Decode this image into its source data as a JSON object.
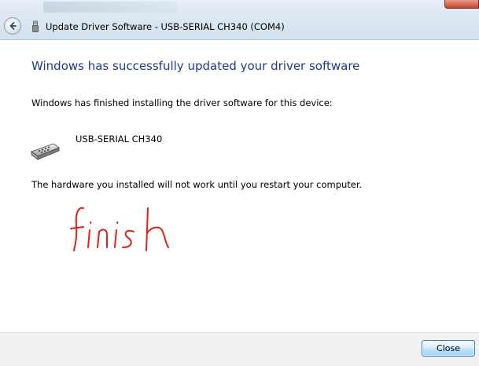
{
  "window": {
    "title": "Update Driver Software - USB-SERIAL CH340 (COM4)"
  },
  "content": {
    "heading": "Windows has successfully updated your driver software",
    "finished_text": "Windows has finished installing the driver software for this device:",
    "device_name": "USB-SERIAL CH340",
    "restart_notice": "The hardware you installed will not work until you restart your computer.",
    "handwritten_note": "finish"
  },
  "footer": {
    "close_label": "Close"
  },
  "colors": {
    "heading": "#1e3a8c",
    "annotation": "#e0201a",
    "button_border": "#3c7fb1"
  },
  "icons": {
    "back": "back-arrow-icon",
    "device": "serial-port-icon"
  }
}
